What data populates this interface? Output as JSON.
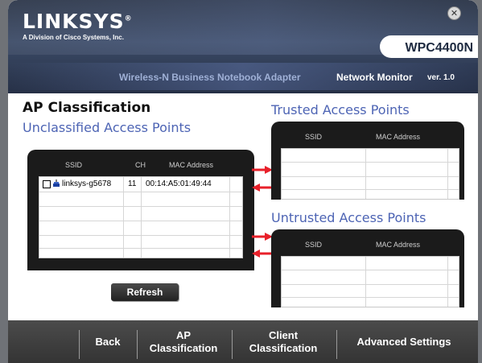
{
  "header": {
    "logo": "LINKSYS",
    "logo_registered": "®",
    "logo_subtitle": "A Division of Cisco Systems, Inc.",
    "model": "WPC4400N",
    "product_name": "Wireless-N Business Notebook Adapter",
    "app_name": "Network Monitor",
    "app_version": "ver. 1.0",
    "close_symbol": "✕"
  },
  "page": {
    "title": "AP Classification"
  },
  "unclassified": {
    "title": "Unclassified Access Points",
    "columns": [
      "SSID",
      "CH",
      "MAC Address"
    ],
    "rows": [
      {
        "ssid": "linksys-g5678",
        "ch": "11",
        "mac": "00:14:A5:01:49:44",
        "checked": false
      }
    ]
  },
  "trusted": {
    "title": "Trusted Access Points",
    "columns": [
      "SSID",
      "MAC Address"
    ],
    "rows": []
  },
  "untrusted": {
    "title": "Untrusted Access Points",
    "columns": [
      "SSID",
      "MAC Address"
    ],
    "rows": []
  },
  "buttons": {
    "refresh": "Refresh"
  },
  "footer": {
    "back": "Back",
    "ap_class_line1": "AP",
    "ap_class_line2": "Classification",
    "client_class_line1": "Client",
    "client_class_line2": "Classification",
    "advanced": "Advanced Settings"
  },
  "colors": {
    "accent_blue": "#4d64b4",
    "arrow_red": "#e8202a",
    "panel_dark": "#1b1b1b"
  },
  "icons": {
    "close": "close-icon",
    "arrow_to_trusted": "arrow-right-icon",
    "arrow_from_trusted": "arrow-left-icon",
    "arrow_to_untrusted": "arrow-right-icon",
    "arrow_from_untrusted": "arrow-left-icon",
    "ap_device": "access-point-icon"
  }
}
